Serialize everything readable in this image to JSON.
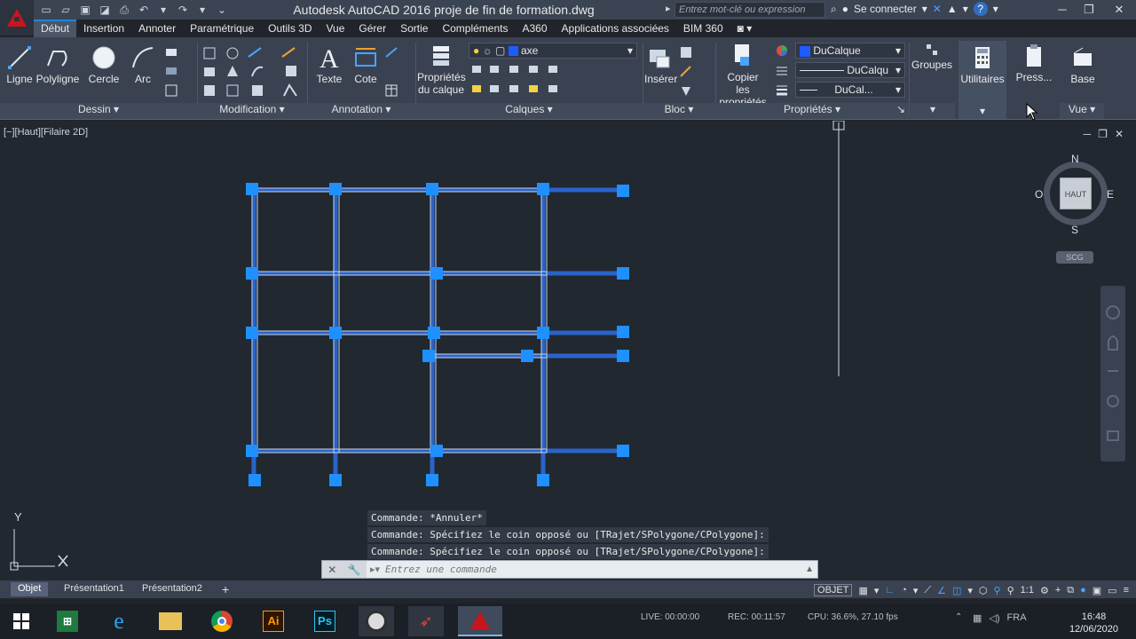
{
  "app": {
    "title": "Autodesk AutoCAD 2016    proje de fin de formation.dwg",
    "search_placeholder": "Entrez mot-clé ou expression",
    "signin": "Se connecter"
  },
  "tabs": [
    "Début",
    "Insertion",
    "Annoter",
    "Paramétrique",
    "Outils 3D",
    "Vue",
    "Gérer",
    "Sortie",
    "Compléments",
    "A360",
    "Applications associées",
    "BIM 360"
  ],
  "ribbon": {
    "dessin": {
      "ligne": "Ligne",
      "polyligne": "Polyligne",
      "cercle": "Cercle",
      "arc": "Arc",
      "footer": "Dessin"
    },
    "modification": {
      "footer": "Modification"
    },
    "annotation": {
      "texte": "Texte",
      "cote": "Cote",
      "footer": "Annotation"
    },
    "calques": {
      "proprietes_line1": "Propriétés",
      "proprietes_line2": "du calque",
      "layer_name": "axe",
      "footer": "Calques"
    },
    "bloc": {
      "inserer": "Insérer",
      "footer": "Bloc"
    },
    "proprietes": {
      "copier_line1": "Copier",
      "copier_line2": "les propriétés",
      "color": "DuCalque",
      "linetype": "DuCalqu",
      "lineweight": "DuCal...",
      "footer": "Propriétés"
    },
    "groupes": "Groupes",
    "utilitaires": "Utilitaires",
    "presse": "Press...",
    "base": "Base",
    "vue": "Vue"
  },
  "viewport": {
    "label": "[−][Haut][Filaire 2D]",
    "viewcube": {
      "n": "N",
      "s": "S",
      "e": "E",
      "o": "O",
      "face": "HAUT",
      "scg": "SCG"
    },
    "ucs": {
      "y": "Y"
    }
  },
  "command": {
    "history": [
      "Commande: *Annuler*",
      "Commande: Spécifiez le coin opposé ou [TRajet/SPolygone/CPolygone]:",
      "Commande: Spécifiez le coin opposé ou [TRajet/SPolygone/CPolygone]:"
    ],
    "placeholder": "Entrez une commande"
  },
  "layout_tabs": [
    "Objet",
    "Présentation1",
    "Présentation2"
  ],
  "status": {
    "mode": "OBJET",
    "scale": "1:1"
  },
  "taskbar": {
    "rec": "REC: 00:11:57",
    "live": "LIVE: 00:00:00",
    "cpu": "CPU: 36.6%, 27.10 fps",
    "lang": "FRA",
    "time": "16:48",
    "date": "12/06/2020"
  },
  "colors": {
    "accent": "#1c87d8",
    "grip": "#1e90ff",
    "structure": "#2563c9"
  }
}
